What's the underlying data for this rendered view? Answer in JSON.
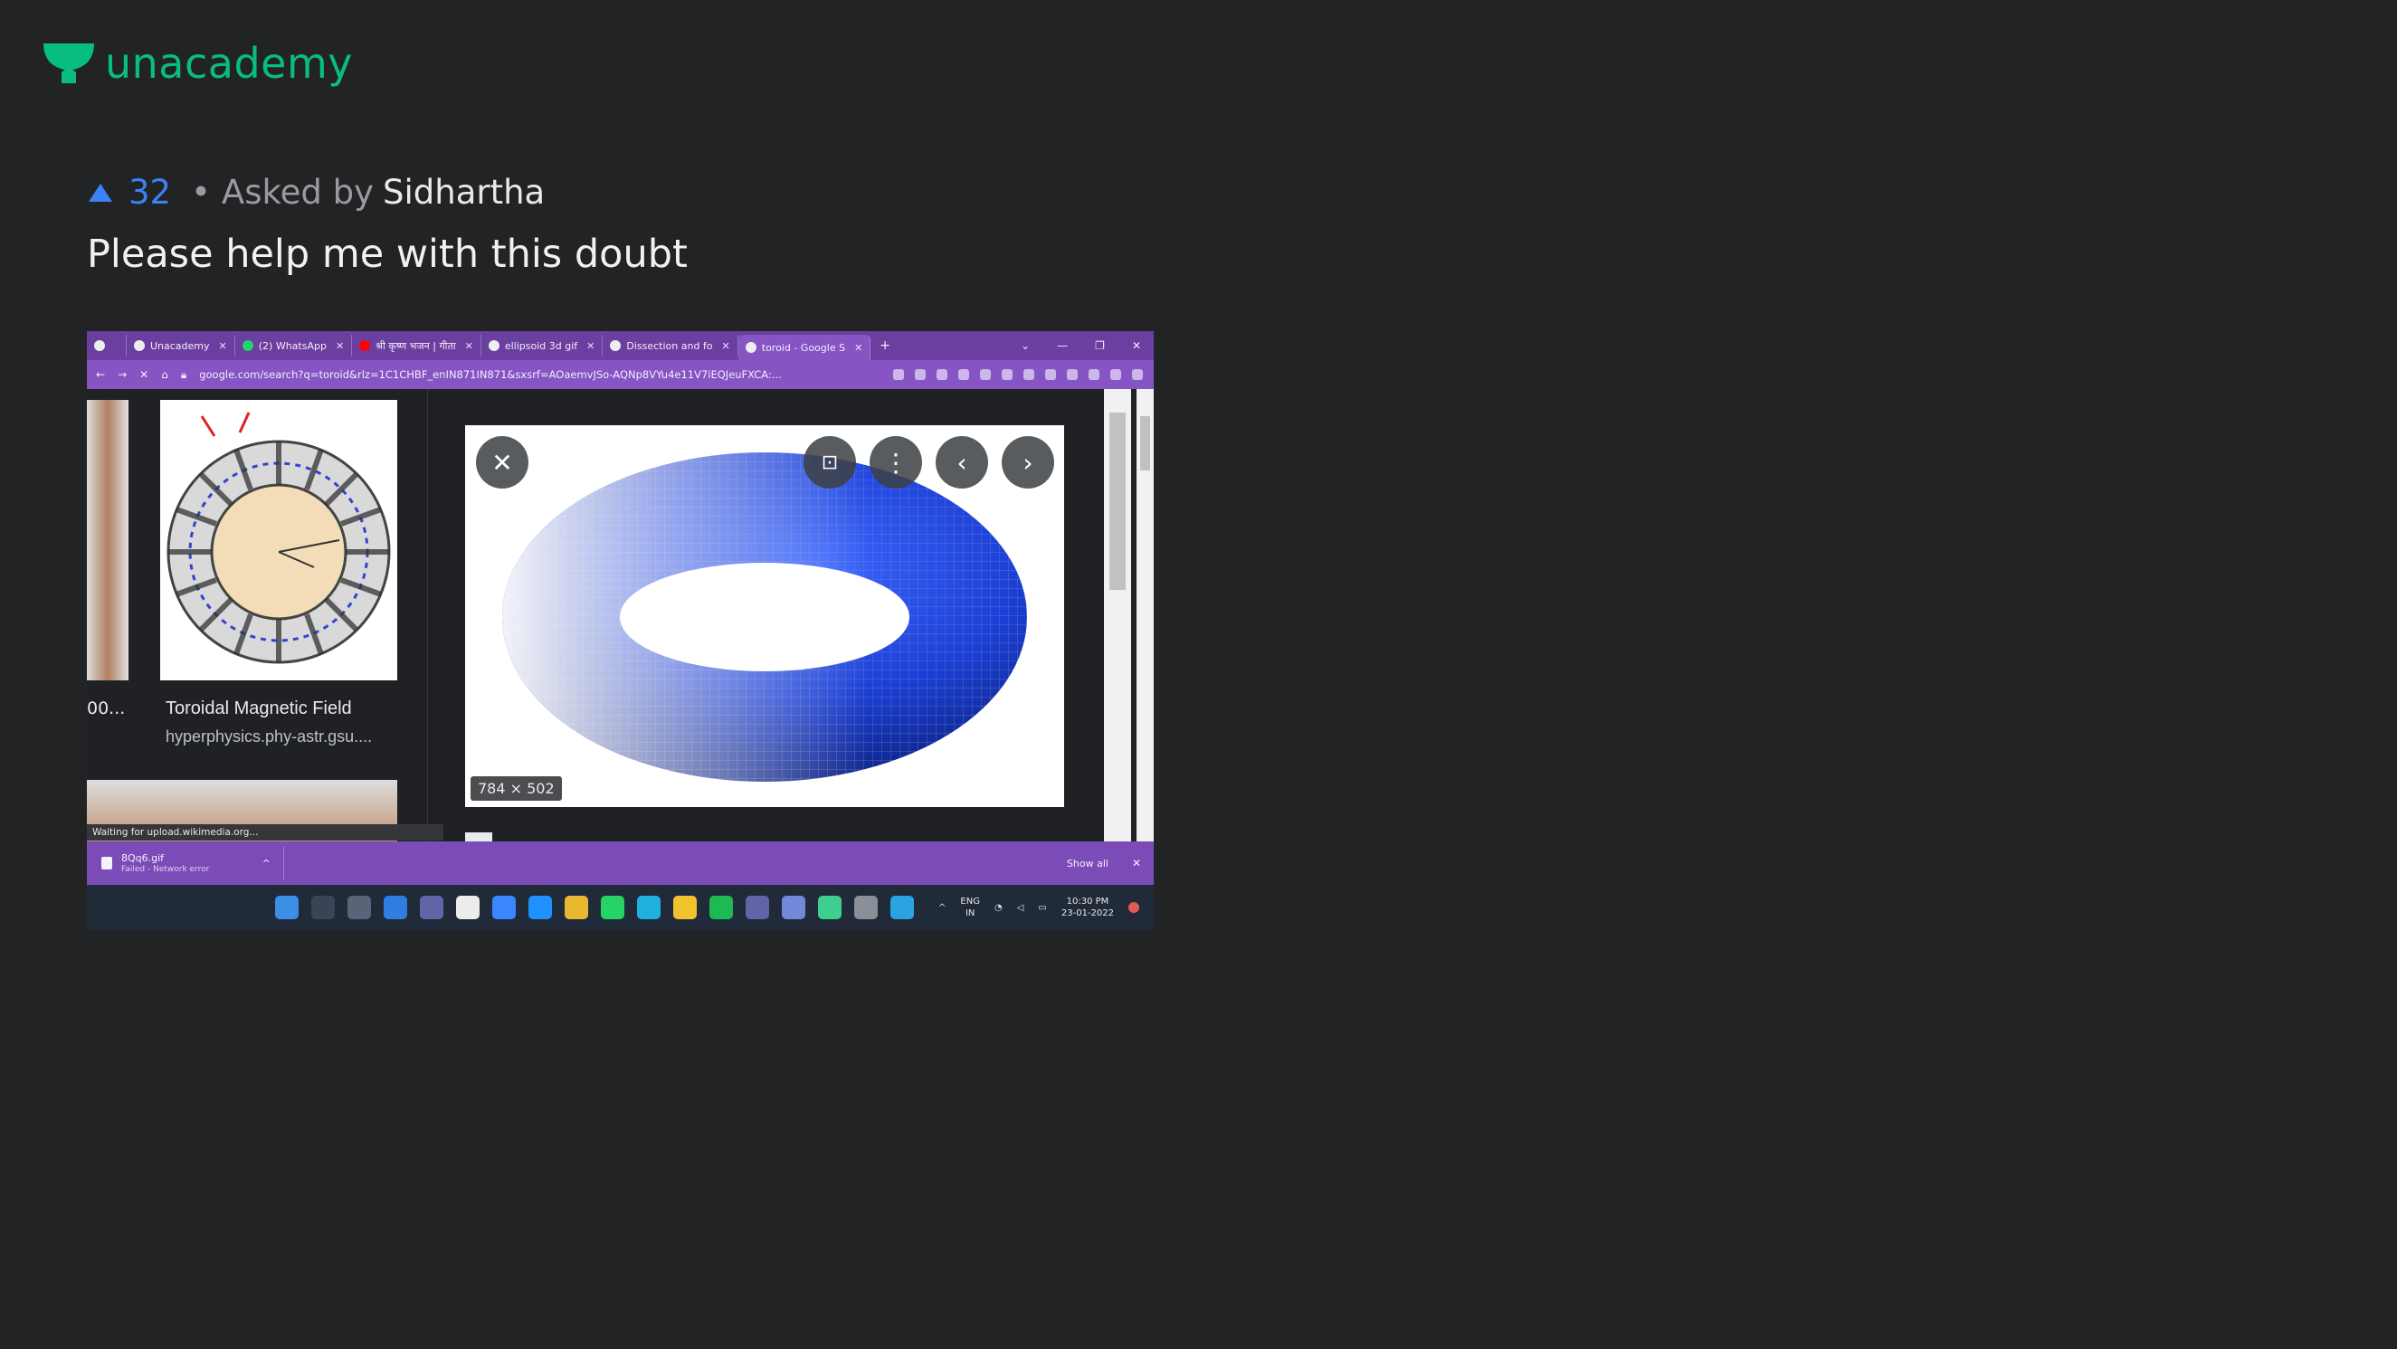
{
  "brand": {
    "name": "unacademy",
    "color": "#08bd80"
  },
  "meta": {
    "votes": "32",
    "separator": "•",
    "asked_by_label": "Asked by",
    "author": "Sidhartha"
  },
  "question": "Please help me with this doubt",
  "screenshot": {
    "tabs": [
      {
        "label": ""
      },
      {
        "label": "Unacademy"
      },
      {
        "label": "(2) WhatsApp"
      },
      {
        "label": "श्री कृष्ण भजन | गीता"
      },
      {
        "label": "ellipsoid 3d gif"
      },
      {
        "label": "Dissection and fo"
      },
      {
        "label": "toroid - Google S"
      }
    ],
    "new_tab": "+",
    "address_url": "google.com/search?q=toroid&rlz=1C1CHBF_enIN871IN871&sxsrf=AOaemvJSo-AQNp8VYu4e11V7iEQJeuFXCA:...",
    "left_caption": "00...",
    "card_title": "Toroidal Magnetic Field",
    "card_site": "hyperphysics.phy-astr.gsu....",
    "preview_dims": "784 × 502",
    "status_text": "Waiting for upload.wikimedia.org...",
    "download": {
      "file": "8Qq6.gif",
      "status": "Failed - Network error",
      "show_all": "Show all"
    },
    "tray": {
      "lang_top": "ENG",
      "lang_bottom": "IN",
      "time": "10:30 PM",
      "date": "23-01-2022"
    },
    "accent": "#6b3fa0"
  },
  "colors": {
    "background": "#222324",
    "vote": "#3b82f6"
  }
}
